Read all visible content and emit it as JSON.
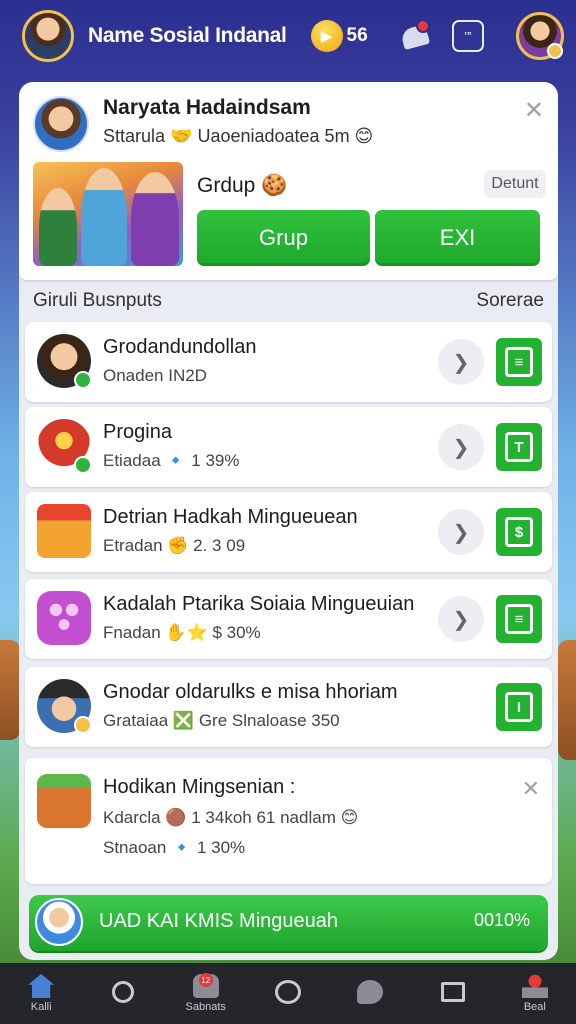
{
  "header": {
    "title": "Name Sosial Indanal",
    "coins": "56",
    "coin_icon": "coin-icon",
    "notification_icon": "bell-icon",
    "message_icon": "message-icon",
    "message_glyph": "’”"
  },
  "profile": {
    "name": "Naryata Hadaindsam",
    "status": "Sttarula  🤝 Uaoeniadoatea 5m 😊",
    "close_glyph": "✕"
  },
  "group": {
    "title": "Grdup 🍪",
    "detail_label": "Detunt",
    "join_label": "Grup",
    "exit_label": "EXI"
  },
  "list_section": {
    "title": "Giruli Busnputs",
    "action": "Sorerae"
  },
  "rows": [
    {
      "title": "Grodandundollan",
      "sub": "Onaden  IN2D",
      "icon_color": "#6b4a2a",
      "has_chevron": true,
      "btn_glyph": "≡"
    },
    {
      "title": "Progina",
      "sub": "Etiadaa  🔹 1 39%",
      "icon_color": "#d33a2a",
      "has_chevron": true,
      "btn_glyph": "T"
    },
    {
      "title": "Detrian Hadkah Mingueuean",
      "sub": "Etradan  ✊ 2. 3 09",
      "icon_color": "#f3a430",
      "has_chevron": true,
      "btn_glyph": "$"
    },
    {
      "title": "Kadalah Ptarika Soiaia Mingueuian",
      "sub": "Fnadan  ✋⭐ $ 30%",
      "icon_color": "#c24fd0",
      "has_chevron": true,
      "btn_glyph": "≡"
    },
    {
      "title": "Gnodar oldarulks e misa hhoriam",
      "sub": "Grataiaa  ❎ Gre Slnaloase 350",
      "icon_color": "#3c6fb0",
      "has_chevron": false,
      "btn_glyph": "I"
    }
  ],
  "big_card": {
    "title": "Hodikan Mingsenian  :",
    "sub1": "Kdarcla  🟤 1 34koh 61 nadlam 😊",
    "sub2": "Stnaoan  🔹 1 30%",
    "close_glyph": "✕"
  },
  "progress": {
    "label": "UAD KAI KMIS Mingueuah",
    "value": "0010%",
    "accent": "#2bb83a"
  },
  "nav": {
    "items": [
      {
        "label": "Kalli",
        "icon": "home-icon"
      },
      {
        "label": "",
        "icon": "search-icon"
      },
      {
        "label": "Sabnats",
        "icon": "bag-icon",
        "badge": "12"
      },
      {
        "label": "",
        "icon": "circle-icon"
      },
      {
        "label": "",
        "icon": "chat-icon"
      },
      {
        "label": "",
        "icon": "square-icon"
      },
      {
        "label": "Beal",
        "icon": "person-icon"
      }
    ]
  },
  "colors": {
    "primary_green": "#23b230",
    "header_blue": "#2b2f8f",
    "danger": "#e5393b",
    "gold": "#f3c04a"
  }
}
